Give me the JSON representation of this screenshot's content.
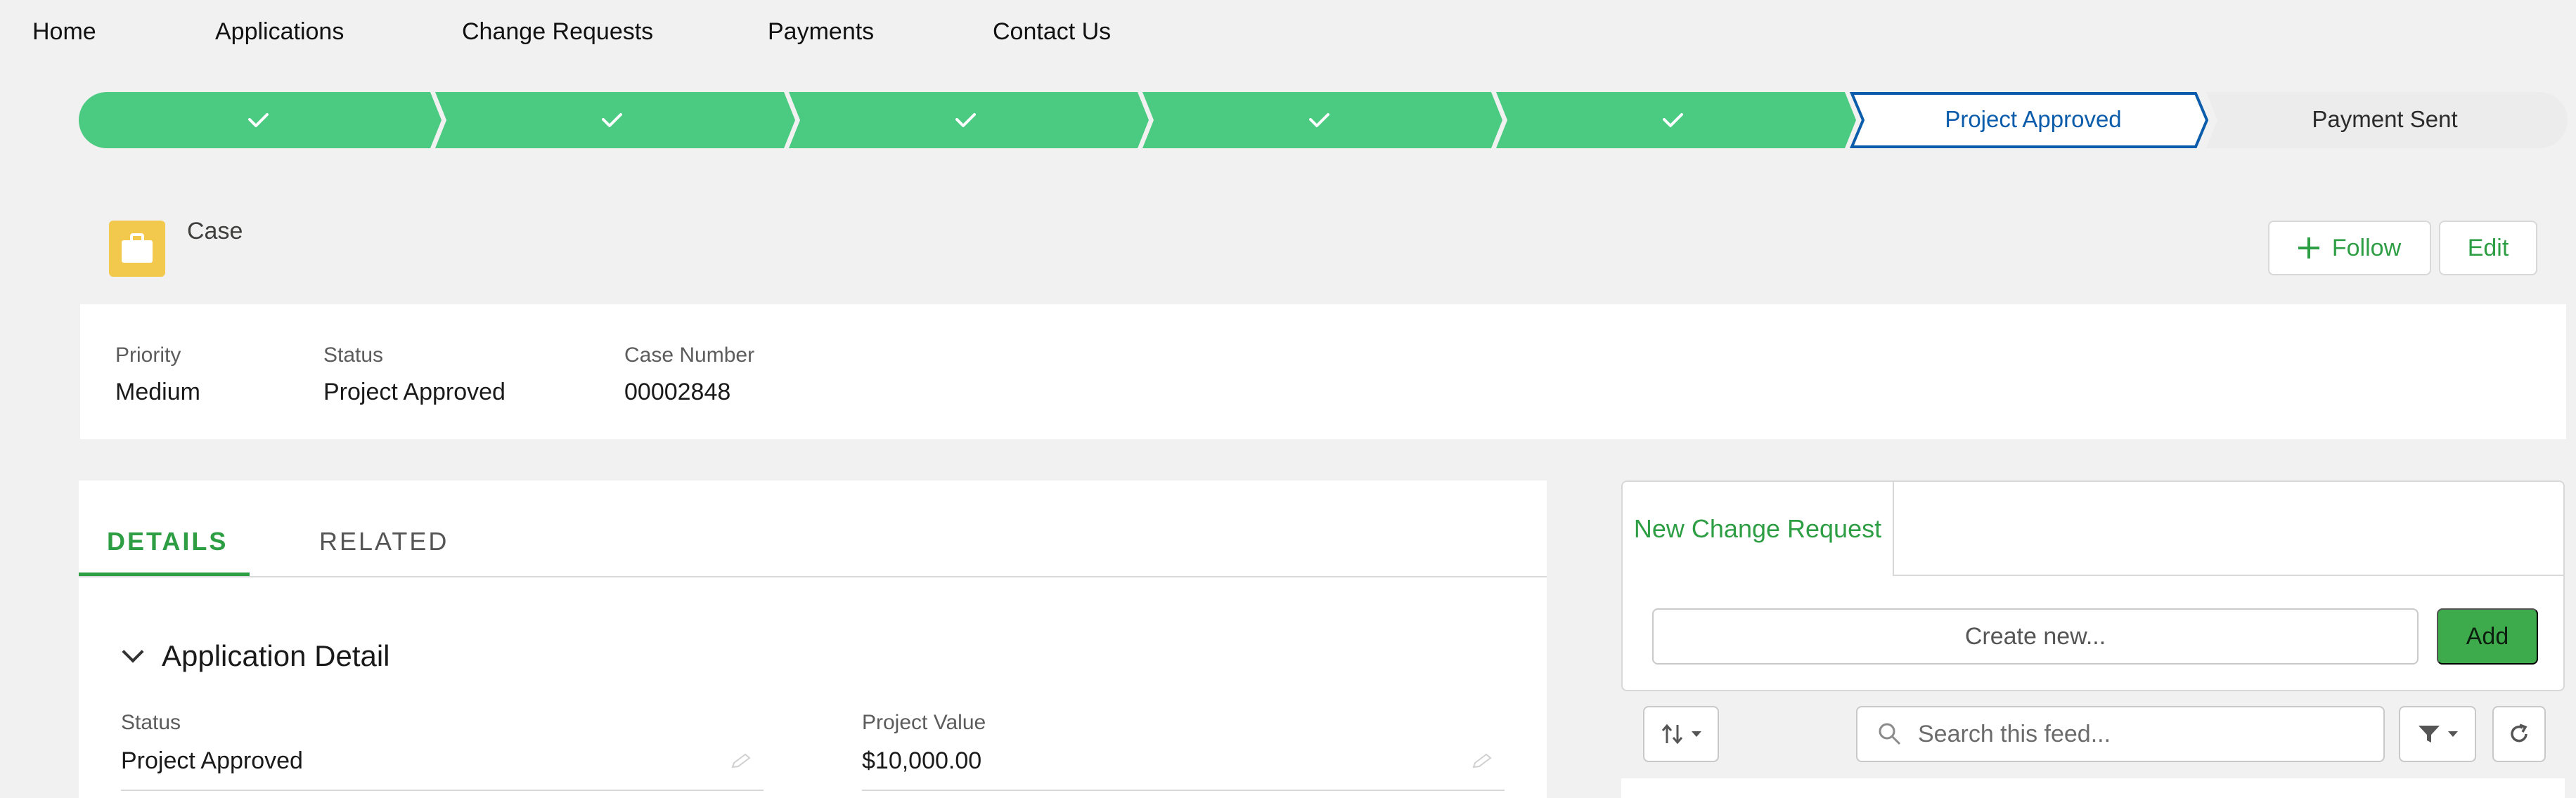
{
  "nav": {
    "items": [
      "Home",
      "Applications",
      "Change Requests",
      "Payments",
      "Contact Us"
    ]
  },
  "path": {
    "completed_stage_count": 5,
    "current_stage": "Project Approved",
    "next_stage": "Payment Sent",
    "colors": {
      "completed": "#4bca81",
      "current_border": "#0b5cab",
      "current_text": "#0b5cab",
      "upcoming": "#ececec"
    }
  },
  "record": {
    "object_label": "Case",
    "icon": "briefcase-icon",
    "follow_label": "Follow",
    "edit_label": "Edit"
  },
  "highlights": [
    {
      "label": "Priority",
      "value": "Medium"
    },
    {
      "label": "Status",
      "value": "Project Approved"
    },
    {
      "label": "Case Number",
      "value": "00002848"
    }
  ],
  "tabs": {
    "details": "DETAILS",
    "related": "RELATED"
  },
  "section": {
    "title": "Application Detail",
    "fields": [
      {
        "label": "Status",
        "value": "Project Approved"
      },
      {
        "label": "Project Value",
        "value": "$10,000.00"
      }
    ]
  },
  "publisher": {
    "tab_label": "New Change Request",
    "input_placeholder": "Create new...",
    "add_label": "Add"
  },
  "feed": {
    "search_placeholder": "Search this feed..."
  },
  "accent_color": "#2e9e44"
}
